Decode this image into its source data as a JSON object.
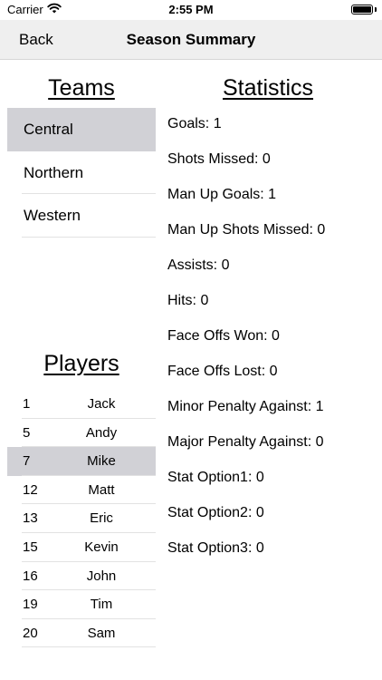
{
  "status_bar": {
    "carrier": "Carrier",
    "wifi_icon": "wifi-icon",
    "time": "2:55 PM",
    "battery_icon": "battery-icon",
    "battery_level": 1.0
  },
  "nav": {
    "back_label": "Back",
    "title": "Season Summary"
  },
  "teams": {
    "header": "Teams",
    "items": [
      {
        "name": "Central",
        "selected": true
      },
      {
        "name": "Northern",
        "selected": false
      },
      {
        "name": "Western",
        "selected": false
      }
    ]
  },
  "players": {
    "header": "Players",
    "items": [
      {
        "number": "1",
        "name": "Jack",
        "selected": false
      },
      {
        "number": "5",
        "name": "Andy",
        "selected": false
      },
      {
        "number": "7",
        "name": "Mike",
        "selected": true
      },
      {
        "number": "12",
        "name": "Matt",
        "selected": false
      },
      {
        "number": "13",
        "name": "Eric",
        "selected": false
      },
      {
        "number": "15",
        "name": "Kevin",
        "selected": false
      },
      {
        "number": "16",
        "name": "John",
        "selected": false
      },
      {
        "number": "19",
        "name": "Tim",
        "selected": false
      },
      {
        "number": "20",
        "name": "Sam",
        "selected": false
      }
    ]
  },
  "statistics": {
    "header": "Statistics",
    "items": [
      "Goals: 1",
      "Shots Missed: 0",
      "Man Up Goals: 1",
      "Man Up Shots Missed: 0",
      "Assists: 0",
      "Hits: 0",
      "Face Offs Won: 0",
      "Face Offs Lost: 0",
      "Minor Penalty Against: 1",
      "Major Penalty Against: 0",
      "Stat Option1: 0",
      "Stat Option2: 0",
      "Stat Option3: 0"
    ]
  }
}
